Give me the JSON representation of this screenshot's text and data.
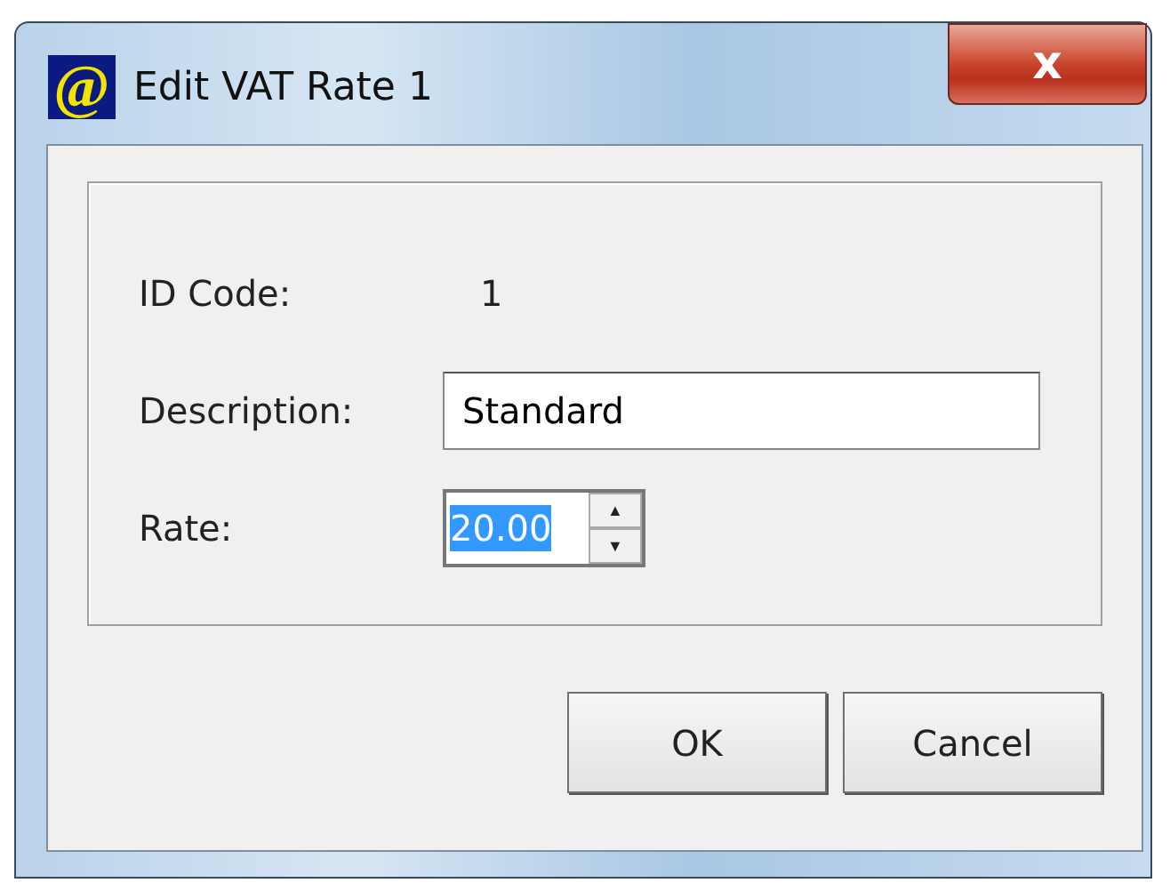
{
  "window": {
    "icon": "@",
    "title": "Edit VAT Rate 1",
    "close_label": "x"
  },
  "fields": [
    {
      "kind": "text",
      "label": "ID Code:",
      "value": "1"
    },
    {
      "kind": "input",
      "label": "Description:",
      "value": "Standard"
    },
    {
      "kind": "spinner",
      "label": "Rate:",
      "value": "20.00",
      "value_selected": true,
      "up": "▲",
      "down": "▼"
    }
  ],
  "buttons": [
    {
      "label": "OK"
    },
    {
      "label": "Cancel"
    }
  ]
}
